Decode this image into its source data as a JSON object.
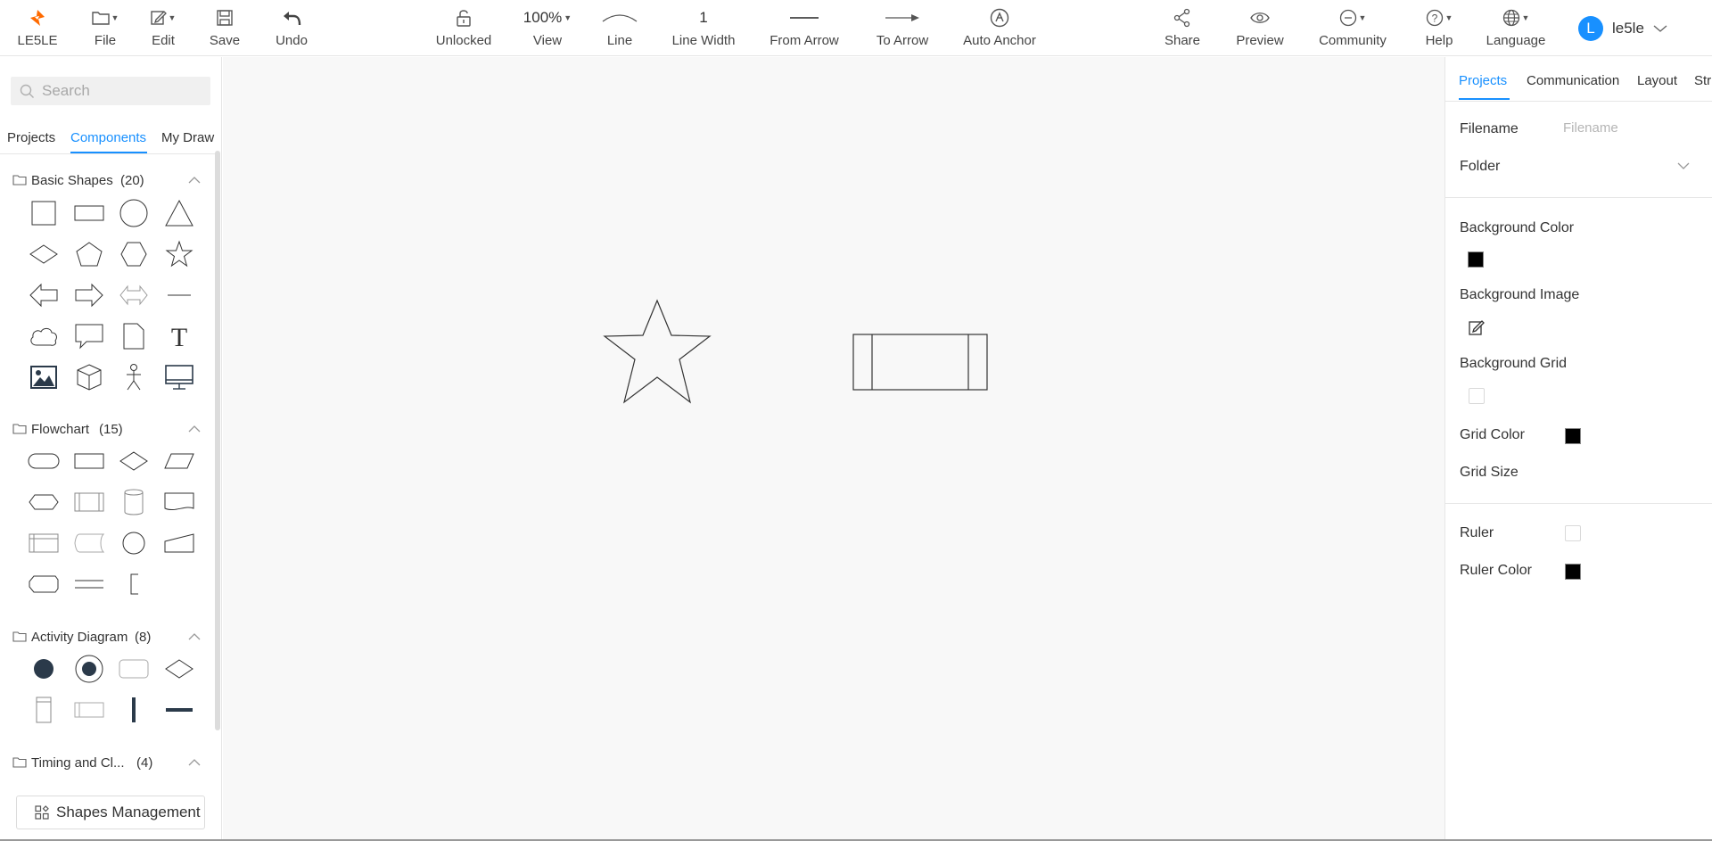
{
  "toolbar": {
    "logo_label": "LE5LE",
    "file_label": "File",
    "edit_label": "Edit",
    "save_label": "Save",
    "undo_label": "Undo",
    "lock_label": "Unlocked",
    "zoom_value": "100%",
    "view_label": "View",
    "line_label": "Line",
    "line_width_value": "1",
    "line_width_label": "Line Width",
    "from_arrow_label": "From Arrow",
    "to_arrow_label": "To Arrow",
    "auto_anchor_label": "Auto Anchor",
    "share_label": "Share",
    "preview_label": "Preview",
    "community_label": "Community",
    "help_label": "Help",
    "language_label": "Language",
    "user_initial": "L",
    "user_name": "le5le",
    "logo_color": "#ff6a00"
  },
  "left": {
    "search_placeholder": "Search",
    "tabs": [
      "Projects",
      "Components",
      "My Draw"
    ],
    "active_tab": "Components",
    "sections": [
      {
        "title": "Basic Shapes",
        "count": "(20)"
      },
      {
        "title": "Flowchart",
        "count": "(15)"
      },
      {
        "title": "Activity Diagram",
        "count": "(8)"
      },
      {
        "title": "Timing and Cl...",
        "count": "(4)"
      }
    ],
    "shapes_management_label": "Shapes Management"
  },
  "right": {
    "tabs": [
      "Projects",
      "Communication",
      "Layout",
      "Str"
    ],
    "active_tab": "Projects",
    "filename_label": "Filename",
    "filename_placeholder": "Filename",
    "folder_label": "Folder",
    "bg_color_label": "Background Color",
    "bg_color_value": "#000000",
    "bg_image_label": "Background Image",
    "bg_grid_label": "Background Grid",
    "grid_color_label": "Grid Color",
    "grid_color_value": "#000000",
    "grid_size_label": "Grid Size",
    "ruler_label": "Ruler",
    "ruler_color_label": "Ruler Color",
    "ruler_color_value": "#000000"
  },
  "accent_color": "#1890ff"
}
